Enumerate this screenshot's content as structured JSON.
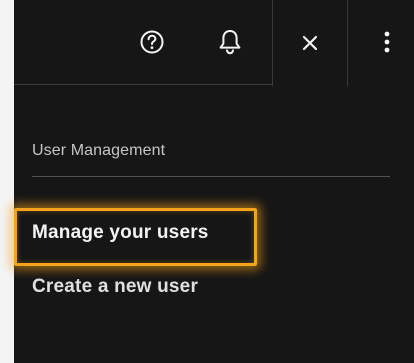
{
  "header": {
    "icons": {
      "help": "help-icon",
      "notifications": "bell-icon",
      "close": "close-icon",
      "overflow": "overflow-menu-icon"
    }
  },
  "panel": {
    "section_title": "User Management",
    "links": [
      {
        "label": "Manage your users",
        "highlighted": true
      },
      {
        "label": "Create a new user",
        "highlighted": false
      }
    ]
  },
  "colors": {
    "background": "#161616",
    "text_primary": "#f4f4f4",
    "text_secondary": "#c6c6c6",
    "highlight": "#f5a31a",
    "divider": "#393939"
  }
}
